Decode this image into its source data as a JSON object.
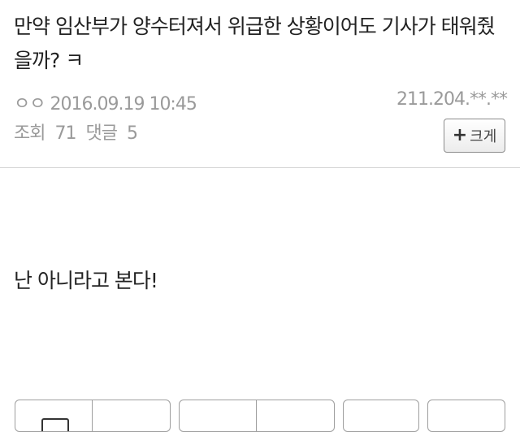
{
  "post": {
    "title": "만약 임산부가 양수터져서 위급한 상황이어도 기사가 태워줬을까? ㅋ",
    "author_display": "ㅇㅇ",
    "datetime": "2016.09.19 10:45",
    "ip": "211.204.**.**",
    "views_label": "조회",
    "views": "71",
    "comments_label": "댓글",
    "comments": "5",
    "body": "난 아니라고 본다!"
  },
  "controls": {
    "font_size_button_label": "크게",
    "plus_symbol": "+"
  },
  "icons": {
    "font_size": "plus-icon"
  }
}
